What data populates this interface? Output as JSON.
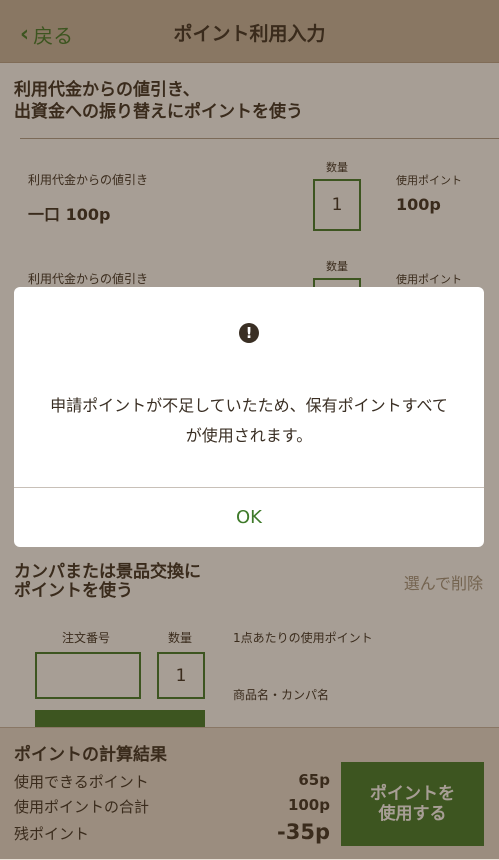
{
  "header": {
    "back_label": "戻る",
    "title": "ポイント利用入力"
  },
  "section1": {
    "title_line1": "利用代金からの値引き、",
    "title_line2": "出資金への振り替えにポイントを使う",
    "rows": [
      {
        "label": "利用代金からの値引き",
        "value": "一口 100p",
        "qty_caption": "数量",
        "qty": "1",
        "use_caption": "使用ポイント",
        "use_value": "100p"
      },
      {
        "label": "利用代金からの値引き",
        "value": "",
        "qty_caption": "数量",
        "qty": "",
        "use_caption": "使用ポイント",
        "use_value": ""
      }
    ]
  },
  "section2": {
    "title_line1": "カンパまたは景品交換に",
    "title_line2": "ポイントを使う",
    "link": "選んで削除",
    "order_caption": "注文番号",
    "qty_caption": "数量",
    "qty": "1",
    "per_item_caption": "1点あたりの使用ポイント",
    "product_caption": "商品名・カンパ名"
  },
  "footer": {
    "title": "ポイントの計算結果",
    "available_label": "使用できるポイント",
    "available_value": "65p",
    "total_label": "使用ポイントの合計",
    "total_value": "100p",
    "remain_label": "残ポイント",
    "remain_value": "-35p",
    "button_line1": "ポイントを",
    "button_line2": "使用する"
  },
  "dialog": {
    "message_line1": "申請ポイントが不足していたため、保有ポイントすべて",
    "message_line2": "が使用されます。",
    "ok_label": "OK"
  },
  "colors": {
    "accent": "#3f7a2a",
    "header_bg": "#c9b8a4",
    "overlay": "rgba(60,40,20,0.45)"
  }
}
